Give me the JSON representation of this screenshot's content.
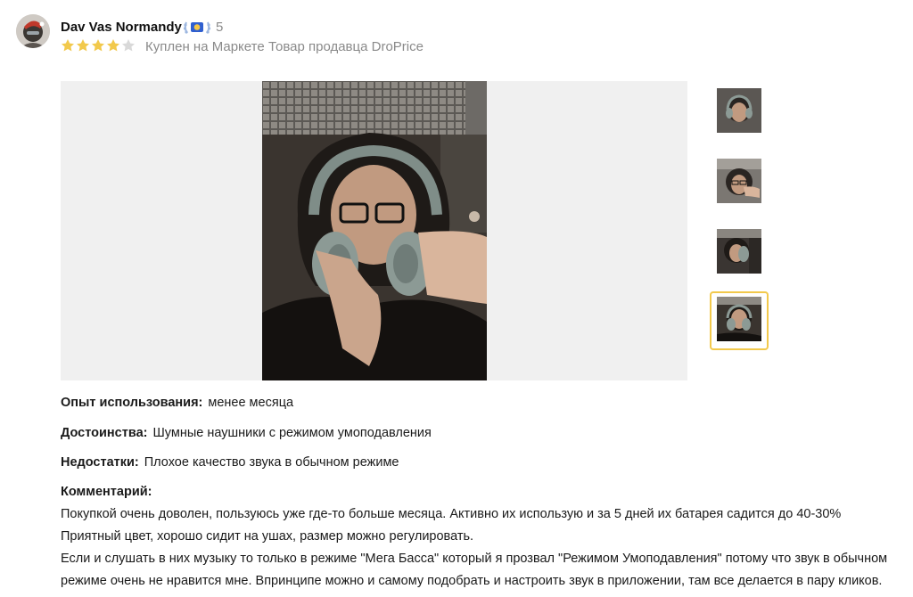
{
  "review": {
    "author": "Dav Vas Normandy",
    "badge_count": "5",
    "rating": 4,
    "rating_max": 5,
    "purchase_tag": "Куплен на Маркете",
    "seller_tag": "Товар продавца DroPrice",
    "usage": {
      "label": "Опыт использования:",
      "value": "менее месяца"
    },
    "pros": {
      "label": "Достоинства:",
      "value": "Шумные наушники с режимом умоподавления"
    },
    "cons": {
      "label": "Недостатки:",
      "value": "Плохое качество звука в обычном режиме"
    },
    "comment": {
      "label": "Комментарий:",
      "lines": [
        "Покупкой очень доволен, пользуюсь уже где-то больше месяца. Активно их использую и за 5 дней их батарея садится до 40-30%",
        "Приятный цвет, хорошо сидит на ушах, размер можно регулировать.",
        "Если и слушать в них музыку то только в режиме \"Мега Басса\" который я прозвал \"Режимом Умоподавления\" потому что звук в обычном",
        "режиме очень не нравится мне. Впринципе можно и самому подобрать и настроить звук в приложении, там все делается в пару кликов."
      ]
    }
  },
  "gallery": {
    "thumbnails_count": 4,
    "active_thumbnail": 4
  },
  "colors": {
    "star_filled": "#f2c94c",
    "star_empty": "#d9d9d9",
    "active_frame": "#f2c94c",
    "muted_text": "#8a8a8a"
  },
  "icons": {
    "badge": "laurel-badge-icon",
    "star": "star-icon"
  }
}
